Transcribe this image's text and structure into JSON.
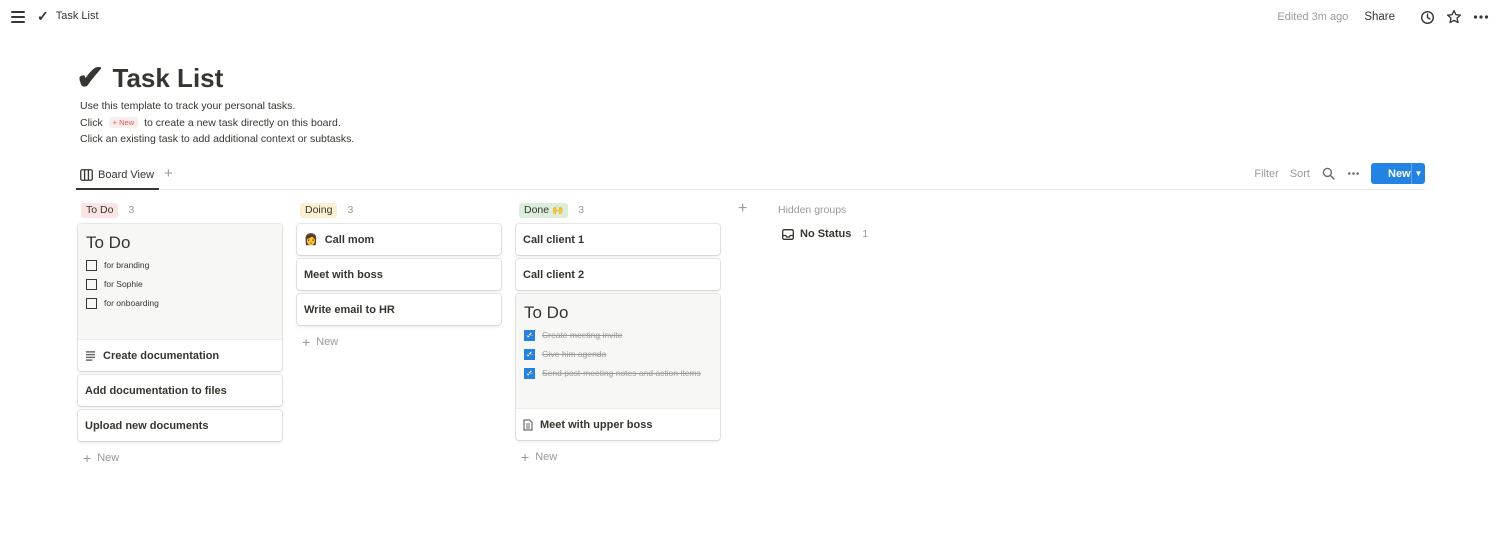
{
  "topbar": {
    "breadcrumb": "Task List",
    "edited": "Edited 3m ago",
    "share": "Share"
  },
  "page": {
    "title": "Task List",
    "desc_line1": "Use this template to track your personal tasks.",
    "desc_line2_pre": "Click",
    "desc_chip": "+ New",
    "desc_line2_post": "to create a new task directly on this board.",
    "desc_line3": "Click an existing task to add additional context or subtasks."
  },
  "view": {
    "tab_label": "Board View",
    "filter": "Filter",
    "sort": "Sort",
    "new_label": "New"
  },
  "colors": {
    "todo_pill": "#fbe4e4",
    "doing_pill": "#fbf0d2",
    "done_pill": "#dbeddb",
    "accent": "#2383e2"
  },
  "columns": [
    {
      "label": "To Do",
      "count": "3",
      "cover": {
        "title": "To Do",
        "items": [
          "for branding",
          "for Sophie",
          "for onboarding"
        ]
      },
      "cards": [
        "Create documentation",
        "Add documentation to files",
        "Upload new documents"
      ],
      "add_new": "New"
    },
    {
      "label": "Doing",
      "count": "3",
      "cards": [
        "Call mom",
        "Meet with boss",
        "Write email to HR"
      ],
      "add_new": "New"
    },
    {
      "label": "Done",
      "label_emoji": "🙌",
      "count": "3",
      "cards": [
        "Call client 1",
        "Call client 2",
        "Meet with upper boss"
      ],
      "cover": {
        "title": "To Do",
        "items": [
          "Create meeting invite",
          "Give him agenda",
          "Send post-meeting notes and action items"
        ]
      },
      "add_new": "New"
    }
  ],
  "hidden": {
    "title": "Hidden groups",
    "no_status": "No Status",
    "no_status_count": "1"
  }
}
